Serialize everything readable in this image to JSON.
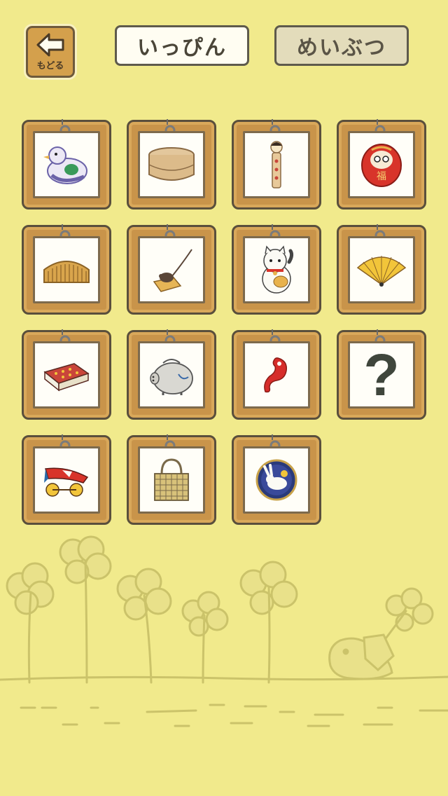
{
  "header": {
    "back_label": "もどる",
    "tab_ippin": "いっぴん",
    "tab_meibutsu": "めいぶつ"
  },
  "items": [
    {
      "icon": "hato-bue-whistle-icon"
    },
    {
      "icon": "bento-box-icon"
    },
    {
      "icon": "kokeshi-doll-icon"
    },
    {
      "icon": "daruma-icon",
      "text": "福"
    },
    {
      "icon": "wooden-comb-icon"
    },
    {
      "icon": "mousetrap-icon"
    },
    {
      "icon": "maneki-neko-icon"
    },
    {
      "icon": "folding-fan-icon"
    },
    {
      "icon": "matchbox-icon"
    },
    {
      "icon": "piggy-bank-icon"
    },
    {
      "icon": "magatama-icon"
    },
    {
      "icon": "unknown-item-icon",
      "text": "?"
    },
    {
      "icon": "koi-carp-toy-icon"
    },
    {
      "icon": "woven-basket-icon"
    },
    {
      "icon": "rabbit-plate-icon"
    }
  ],
  "colors": {
    "background": "#f1ea8c",
    "frame_wood": "#c9944a",
    "frame_border": "#5a4f3c",
    "clover": "#d9d37e"
  }
}
